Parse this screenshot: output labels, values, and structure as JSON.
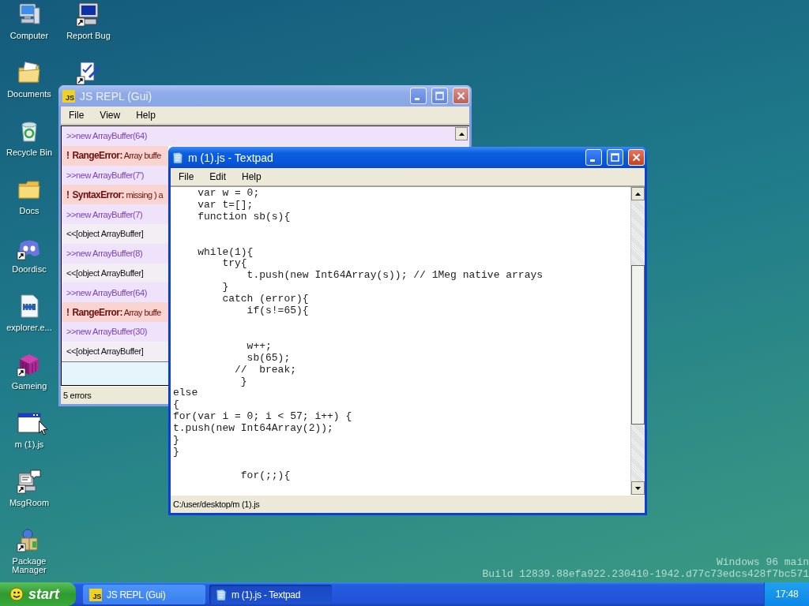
{
  "desktop_icon_columns": [
    {
      "icons": [
        {
          "label": "Computer",
          "kind": "computer",
          "shortcut": false
        },
        {
          "label": "Documents",
          "kind": "documents",
          "shortcut": false
        },
        {
          "label": "Recycle Bin",
          "kind": "recycle",
          "shortcut": false
        },
        {
          "label": "Docs",
          "kind": "folder",
          "shortcut": false
        },
        {
          "label": "Doordisc",
          "kind": "chat",
          "shortcut": true
        },
        {
          "label": "explorer.e...",
          "kind": "film",
          "shortcut": false
        },
        {
          "label": "Gameing",
          "kind": "cube",
          "shortcut": true
        },
        {
          "label": "m (1).js",
          "kind": "window",
          "shortcut": false
        },
        {
          "label": "MsgRoom",
          "kind": "terminal",
          "shortcut": true
        },
        {
          "label": "Package Manager",
          "kind": "package",
          "shortcut": true
        }
      ]
    },
    {
      "icons": [
        {
          "label": "Report Bug",
          "kind": "monitor",
          "shortcut": true
        },
        {
          "kind": "checklist",
          "shortcut": true
        }
      ]
    }
  ],
  "repl_window": {
    "title": "JS REPL (Gui)",
    "icon_label": "JS",
    "active": false,
    "menu": [
      "File",
      "View",
      "Help"
    ],
    "rows": [
      {
        "kind": "input",
        "text": ">>new ArrayBuffer(64)"
      },
      {
        "kind": "error",
        "mark": "!",
        "name": "RangeError:",
        "message": "Array buffe"
      },
      {
        "kind": "input",
        "text": ">>new ArrayBuffer(7')"
      },
      {
        "kind": "error",
        "mark": "!",
        "name": "SyntaxError:",
        "message": "missing ) a"
      },
      {
        "kind": "input",
        "text": ">>new ArrayBuffer(7)"
      },
      {
        "kind": "output",
        "text": "<<[object ArrayBuffer]"
      },
      {
        "kind": "input",
        "text": ">>new ArrayBuffer(8)"
      },
      {
        "kind": "output",
        "text": "<<[object ArrayBuffer]"
      },
      {
        "kind": "input",
        "text": ">>new ArrayBuffer(64)"
      },
      {
        "kind": "error",
        "mark": "!",
        "name": "RangeError:",
        "message": "Array buffe"
      },
      {
        "kind": "input",
        "text": ">>new ArrayBuffer(30)"
      },
      {
        "kind": "output",
        "text": "<<[object ArrayBuffer]"
      }
    ],
    "status_bar": "5 errors"
  },
  "textpad_window": {
    "title": "m (1).js - Textpad",
    "active": true,
    "menu": [
      "File",
      "Edit",
      "Help"
    ],
    "code": "    var w = 0;\n    var t=[];\n    function sb(s){\n\n\n    while(1){\n        try{\n            t.push(new Int64Array(s)); // 1Meg native arrays\n        }\n        catch (error){\n            if(s!=65){\n\n\n            w++;\n            sb(65);\n          //  break;\n           }\nelse\n{\nfor(var i = 0; i < 57; i++) {\nt.push(new Int64Array(2));\n}\n}\n\n           for(;;){",
    "status_bar": "C:/user/desktop/m (1).js"
  },
  "build_info": [
    "Windows 96 main",
    "Build 12839.88efa922.230410-1942.d77c73edcs428f7bc571"
  ],
  "taskbar": {
    "start_label": "start",
    "tasks": [
      {
        "label": "JS REPL (Gui)",
        "kind": "js",
        "icon_label": "JS",
        "selected": false
      },
      {
        "label": "m (1).js - Textpad",
        "kind": "doc",
        "selected": true
      }
    ],
    "clock": "17:48"
  }
}
